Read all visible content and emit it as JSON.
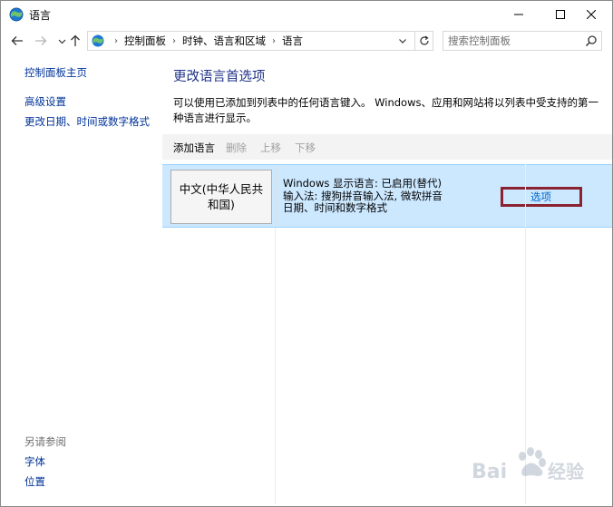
{
  "window": {
    "title": "语言"
  },
  "address_bar": {
    "breadcrumbs": [
      "控制面板",
      "时钟、语言和区域",
      "语言"
    ]
  },
  "search": {
    "placeholder": "搜索控制面板"
  },
  "sidebar": {
    "home": "控制面板主页",
    "items": [
      "高级设置",
      "更改日期、时间或数字格式"
    ],
    "see_also_heading": "另请参阅",
    "see_also": [
      "字体",
      "位置"
    ]
  },
  "main": {
    "title": "更改语言首选项",
    "description": "可以使用已添加到列表中的任何语言键入。 Windows、应用和网站将以列表中受支持的第一种语言进行显示。",
    "toolbar": {
      "add": "添加语言",
      "delete": "删除",
      "move_up": "上移",
      "move_down": "下移"
    },
    "languages": [
      {
        "name": "中文(中华人民共和国)",
        "info_lines": [
          "Windows 显示语言: 已启用(替代)",
          "输入法: 搜狗拼音输入法, 微软拼音",
          "日期、时间和数字格式"
        ],
        "options_label": "选项"
      }
    ]
  },
  "watermark": {
    "text": "Bai 经验"
  },
  "colors": {
    "link": "#003399",
    "title": "#1e3287",
    "selected_row": "#cce8ff",
    "highlight_box": "#8b2232"
  }
}
